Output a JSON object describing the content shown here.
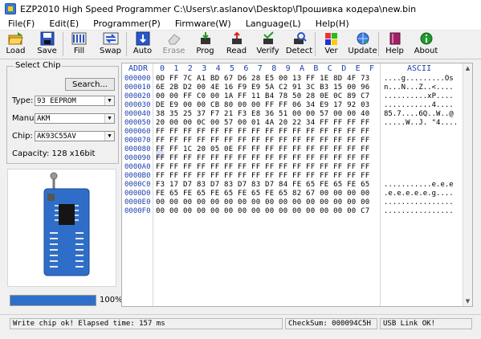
{
  "window": {
    "title": "EZP2010 High Speed Programmer   C:\\Users\\r.aslanov\\Desktop\\Прошивка кодера\\new.bin"
  },
  "menu": [
    "File(F)",
    "Edit(E)",
    "Programmer(P)",
    "Firmware(W)",
    "Language(L)",
    "Help(H)"
  ],
  "toolbar": {
    "load": "Load",
    "save": "Save",
    "fill": "Fill",
    "swap": "Swap",
    "auto": "Auto",
    "erase": "Erase",
    "prog": "Prog",
    "read": "Read",
    "verify": "Verify",
    "detect": "Detect",
    "ver": "Ver",
    "update": "Update",
    "help": "Help",
    "about": "About"
  },
  "chip": {
    "group_title": "Select Chip",
    "search_label": "Search...",
    "type_label": "Type:",
    "type_value": "93 EEPROM",
    "manu_label": "Manu:",
    "manu_value": "AKM",
    "chip_label": "Chip:",
    "chip_value": "AK93C55AV",
    "capacity": "Capacity: 128 x16bit"
  },
  "progress": {
    "value": 1.0,
    "text": "100%"
  },
  "hex": {
    "addr_header": "ADDR",
    "columns": [
      "0",
      "1",
      "2",
      "3",
      "4",
      "5",
      "6",
      "7",
      "8",
      "9",
      "A",
      "B",
      "C",
      "D",
      "E",
      "F"
    ],
    "ascii_header": "ASCII",
    "rows": [
      {
        "addr": "000000",
        "bytes": "0D FF 7C A1 BD 67 D6 28 E5 00 13 FF 1E 8D 4F 73",
        "ascii": "....g.........Os"
      },
      {
        "addr": "000010",
        "bytes": "6E 2B D2 00 4E 16 F9 E9 5A C2 91 3C B3 15 00 96",
        "ascii": "n...N...Z..<...."
      },
      {
        "addr": "000020",
        "bytes": "00 00 FF C0 00 1A FF 11 B4 78 50 28 0E 0C 89 C7",
        "ascii": "..........xP...."
      },
      {
        "addr": "000030",
        "bytes": "DE E9 00 00 CB 80 00 00 FF FF 06 34 E9 17 92 03",
        "ascii": "...........4...."
      },
      {
        "addr": "000040",
        "bytes": "38 35 25 37 F7 21 F3 E8 36 51 00 00 57 00 00 40",
        "ascii": "85.7....6Q..W..@"
      },
      {
        "addr": "000050",
        "bytes": "20 00 00 0C 00 57 00 01 4A 20 22 34 FF FF FF FF",
        "ascii": ".....W..J. \"4...."
      },
      {
        "addr": "000060",
        "bytes": "FF FF FF FF FF FF FF FF FF FF FF FF FF FF FF FF",
        "ascii": ""
      },
      {
        "addr": "000070",
        "bytes": "FF FF FF FF FF FF FF FF FF FF FF FF FF FF FF FF",
        "ascii": ""
      },
      {
        "addr": "000080",
        "bytes": "FF FF 1C 20 05 0E FF FF FF FF FF FF FF FF FF FF",
        "ascii": ""
      },
      {
        "addr": "000090",
        "bytes": "FF FF FF FF FF FF FF FF FF FF FF FF FF FF FF FF",
        "ascii": ""
      },
      {
        "addr": "0000A0",
        "bytes": "FF FF FF FF FF FF FF FF FF FF FF FF FF FF FF FF",
        "ascii": ""
      },
      {
        "addr": "0000B0",
        "bytes": "FF FF FF FF FF FF FF FF FF FF FF FF FF FF FF FF",
        "ascii": ""
      },
      {
        "addr": "0000C0",
        "bytes": "F3 17 D7 83 D7 83 D7 83 D7 84 FE 65 FE 65 FE 65",
        "ascii": "...........e.e.e"
      },
      {
        "addr": "0000D0",
        "bytes": "FE 65 FE 65 FE 65 FE 65 FE 65 82 67 00 00 00 00",
        "ascii": ".e.e.e.e.e.g...."
      },
      {
        "addr": "0000E0",
        "bytes": "00 00 00 00 00 00 00 00 00 00 00 00 00 00 00 00",
        "ascii": "................"
      },
      {
        "addr": "0000F0",
        "bytes": "00 00 00 00 00 00 00 00 00 00 00 00 00 00 00 C7",
        "ascii": "................"
      }
    ]
  },
  "status": {
    "message": "Write chip ok!   Elapsed time: 157 ms",
    "checksum": "CheckSum: 000094C5H",
    "usb": "USB Link OK!"
  },
  "colors": {
    "accent": "#1b3fb0",
    "progress": "#2e6fc9",
    "chip_board": "#2f6ec8"
  }
}
